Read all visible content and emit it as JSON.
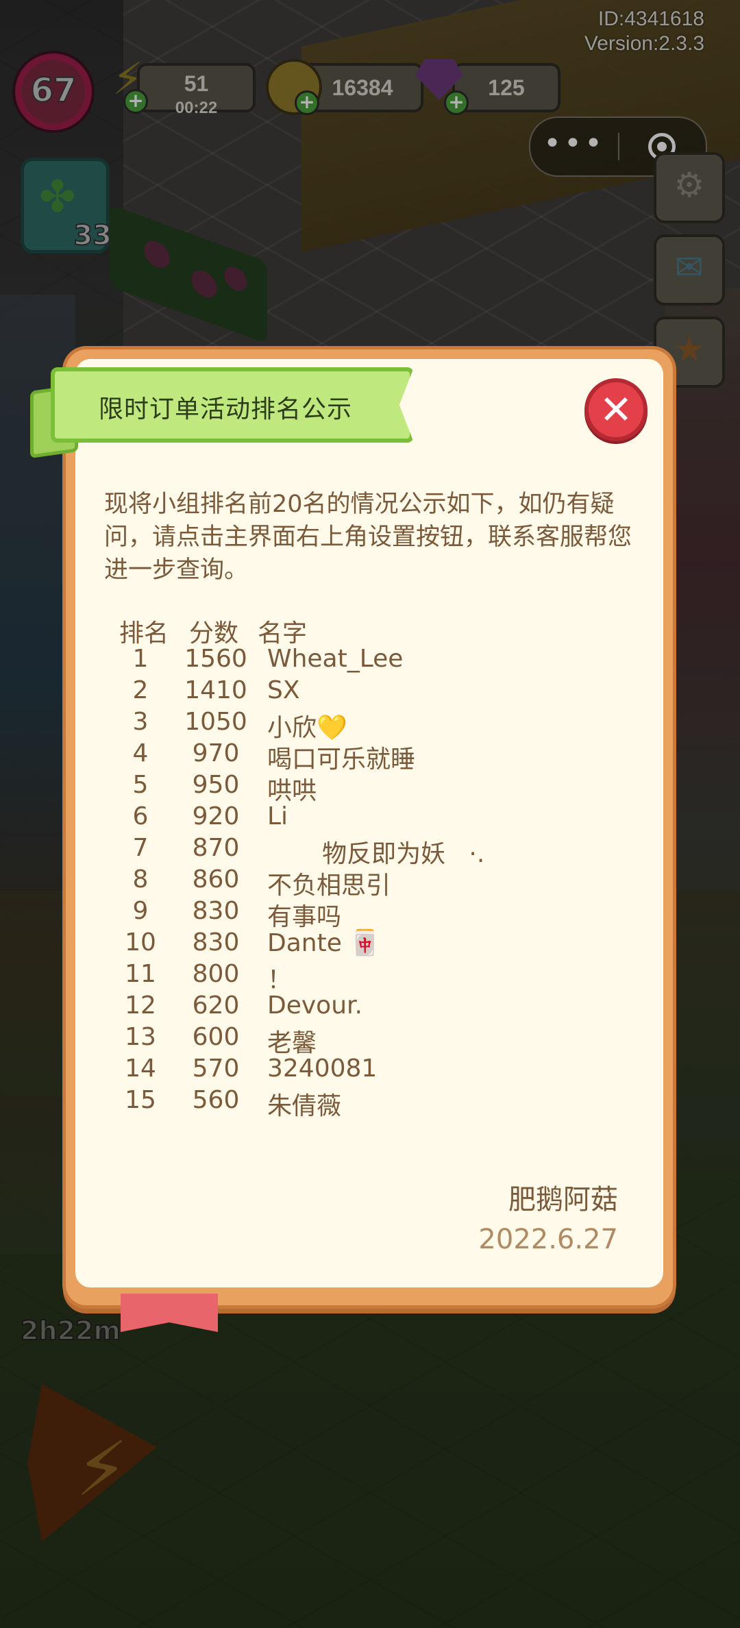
{
  "app": {
    "id_text": "ID:4341618",
    "version_text": "Version:2.3.3"
  },
  "hud": {
    "level": "67",
    "energy": {
      "value": "51",
      "timer": "00:22"
    },
    "coins": "16384",
    "gems": "125",
    "task_count": "33",
    "farm_timer": "2h22m"
  },
  "dialog": {
    "title": "限时订单活动排名公示",
    "intro": "现将小组排名前20名的情况公示如下，如仍有疑问，请点击主界面右上角设置按钮，联系客服帮您进一步查询。",
    "columns": {
      "rank": "排名",
      "score": "分数",
      "name": "名字"
    },
    "rows": [
      {
        "rank": "1",
        "score": "1560",
        "name": "Wheat_Lee"
      },
      {
        "rank": "2",
        "score": "1410",
        "name": "SX"
      },
      {
        "rank": "3",
        "score": "1050",
        "name": "小欣💛"
      },
      {
        "rank": "4",
        "score": "970",
        "name": "喝口可乐就睡"
      },
      {
        "rank": "5",
        "score": "950",
        "name": "哄哄"
      },
      {
        "rank": "6",
        "score": "920",
        "name": "Li"
      },
      {
        "rank": "7",
        "score": "870",
        "name": "       物反即为妖   ·."
      },
      {
        "rank": "8",
        "score": "860",
        "name": "不负相思引"
      },
      {
        "rank": "9",
        "score": "830",
        "name": "有事吗"
      },
      {
        "rank": "10",
        "score": "830",
        "name": "Dante 🀄"
      },
      {
        "rank": "11",
        "score": "800",
        "name": "！"
      },
      {
        "rank": "12",
        "score": "620",
        "name": "Devour."
      },
      {
        "rank": "13",
        "score": "600",
        "name": "老馨"
      },
      {
        "rank": "14",
        "score": "570",
        "name": "3240081"
      },
      {
        "rank": "15",
        "score": "560",
        "name": "朱倩薇"
      }
    ],
    "signature": "肥鹅阿菇",
    "date": "2022.6.27"
  },
  "icons": {
    "energy": "lightning-icon",
    "coin": "coin-icon",
    "gem": "gem-icon",
    "close": "close-icon",
    "more": "more-dots-icon",
    "mini_program": "target-icon"
  },
  "colors": {
    "ribbon": "#bfe97e",
    "close": "#e4404a",
    "panel": "#fffaea",
    "text": "#7a5a3a",
    "frame": "#e9a15f"
  }
}
